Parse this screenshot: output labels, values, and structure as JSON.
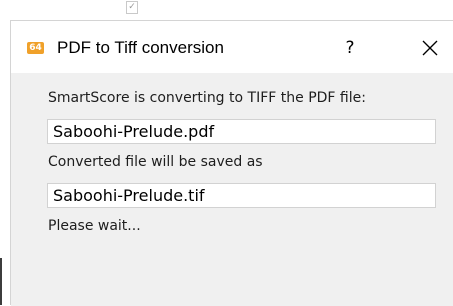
{
  "window": {
    "title": "PDF to Tiff conversion",
    "app_icon_text": "64",
    "help_label": "?",
    "close_icon": "close-icon"
  },
  "content": {
    "converting_label": "SmartScore is converting to TIFF the PDF file:",
    "source_file": "Saboohi-Prelude.pdf",
    "saved_as_label": "Converted file will be saved as",
    "output_file": "Saboohi-Prelude.tif",
    "status": "Please wait..."
  },
  "colors": {
    "content_background": "#f0f0f0",
    "app_icon": "#f0a12a"
  }
}
